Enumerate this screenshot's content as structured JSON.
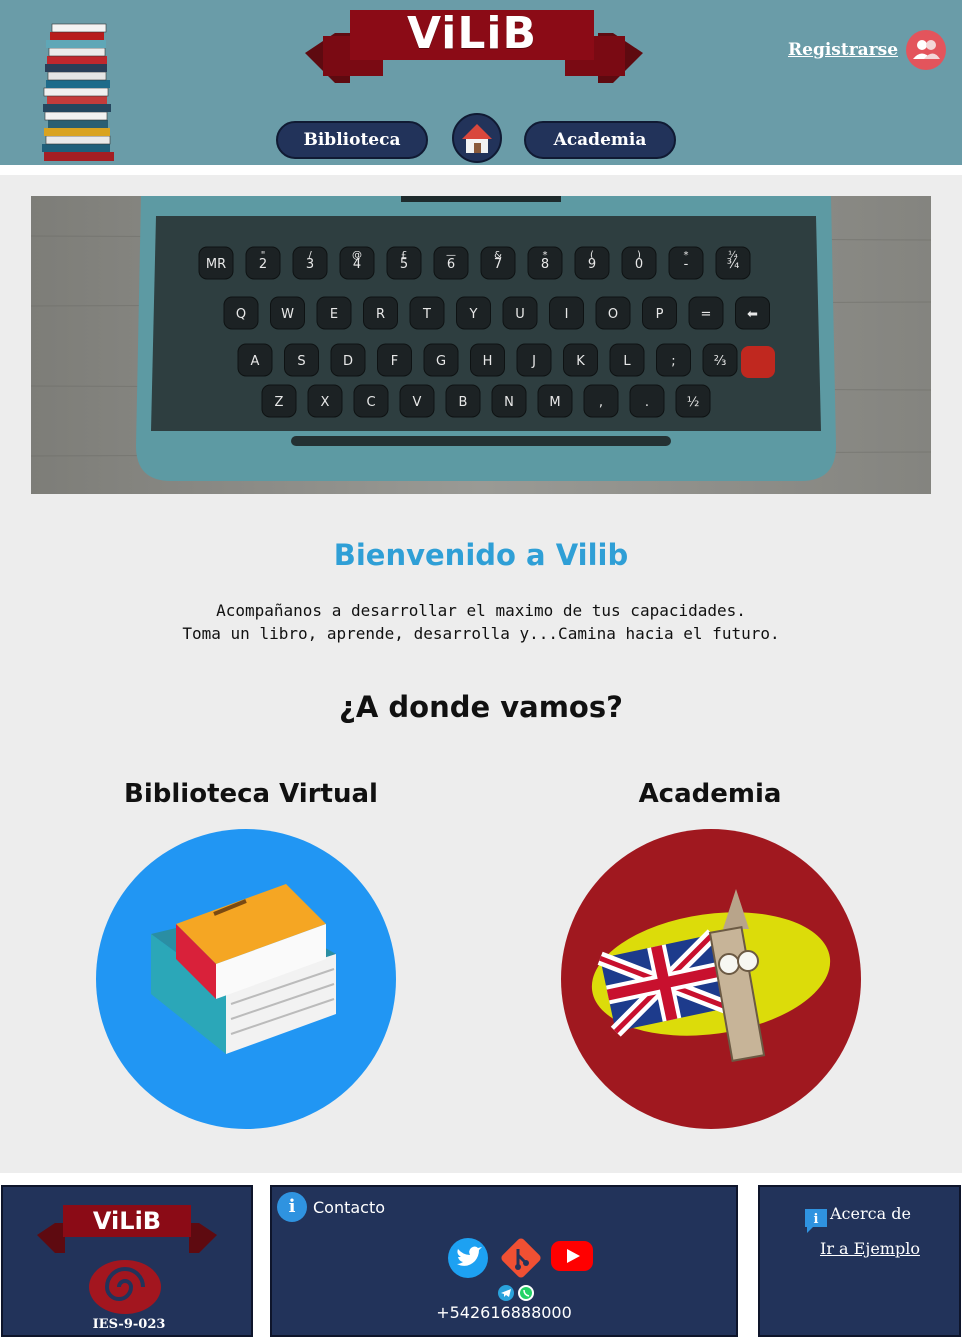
{
  "header": {
    "brand": "ViLiB",
    "nav": {
      "biblioteca": "Biblioteca",
      "academia": "Academia"
    },
    "register": "Registrarse"
  },
  "main": {
    "welcome": "Bienvenido a Vilib",
    "intro_line1": "Acompañanos a desarrollar el maximo de tus capacidades.",
    "intro_line2": "Toma un libro, aprende, desarrolla y...Camina hacia el futuro.",
    "section_title": "¿A donde vamos?",
    "cards": [
      {
        "title": "Biblioteca Virtual",
        "color": "#2196f3"
      },
      {
        "title": "Academia",
        "color": "#a0181f"
      }
    ],
    "typewriter_keys": {
      "row0": [
        "MR",
        "2",
        "3",
        "4",
        "5",
        "6",
        "7",
        "8",
        "9",
        "0",
        "-",
        "¾"
      ],
      "row0_top": [
        "",
        "\"",
        "/",
        "@",
        "£",
        "—",
        "&",
        "*",
        "(",
        ")",
        "*",
        "¼"
      ],
      "row1": [
        "Q",
        "W",
        "E",
        "R",
        "T",
        "Y",
        "U",
        "I",
        "O",
        "P",
        "=",
        "⬅"
      ],
      "row2": [
        "A",
        "S",
        "D",
        "F",
        "G",
        "H",
        "J",
        "K",
        "L",
        ";",
        "⅔"
      ],
      "row3": [
        "Z",
        "X",
        "C",
        "V",
        "B",
        "N",
        "M",
        ",",
        ".",
        "½"
      ]
    }
  },
  "footer": {
    "brand": "ViLiB",
    "institute": "IES-9-023",
    "contact_label": "Contacto",
    "phone": "+542616888000",
    "about_label": "Acerca de",
    "example_link": "Ir a Ejemplo"
  },
  "colors": {
    "header_bg": "#6a9ca8",
    "nav_bg": "#22335a",
    "welcome": "#2f9fd6",
    "footer_bg": "#22335a",
    "brand_ribbon": "#8b0b16"
  }
}
